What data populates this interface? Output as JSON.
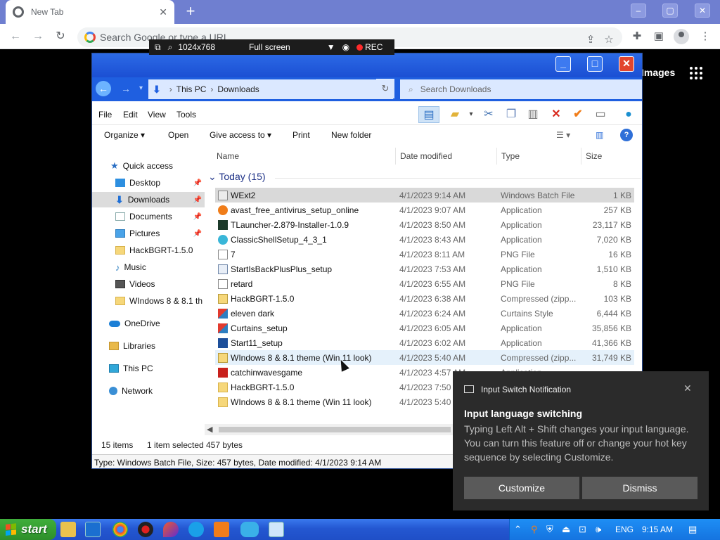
{
  "browser": {
    "tab_title": "New Tab",
    "omnibox_placeholder": "Search Google or type a URL"
  },
  "recorder": {
    "resolution": "1024x768",
    "mode": "Full screen",
    "rec_label": "REC"
  },
  "chrome_page": {
    "images_link": "Images"
  },
  "explorer": {
    "breadcrumb": [
      "This PC",
      "Downloads"
    ],
    "search_placeholder": "Search Downloads",
    "menu": [
      "File",
      "Edit",
      "View",
      "Tools"
    ],
    "commands": [
      "Organize",
      "Open",
      "Give access to",
      "Print",
      "New folder"
    ],
    "nav": [
      {
        "label": "Quick access",
        "icon": "star-icon",
        "pinned": false
      },
      {
        "label": "Desktop",
        "icon": "desktop-icon",
        "pinned": true
      },
      {
        "label": "Downloads",
        "icon": "download-icon",
        "pinned": true,
        "selected": true
      },
      {
        "label": "Documents",
        "icon": "document-icon",
        "pinned": true
      },
      {
        "label": "Pictures",
        "icon": "pictures-icon",
        "pinned": true
      },
      {
        "label": "HackBGRT-1.5.0",
        "icon": "folder-icon",
        "pinned": false
      },
      {
        "label": "Music",
        "icon": "music-icon",
        "pinned": false
      },
      {
        "label": "Videos",
        "icon": "videos-icon",
        "pinned": false
      },
      {
        "label": "WIndows 8 & 8.1 th",
        "icon": "folder-icon",
        "pinned": false
      },
      {
        "label": "OneDrive",
        "icon": "cloud-icon",
        "pinned": false
      },
      {
        "label": "Libraries",
        "icon": "libraries-icon",
        "pinned": false
      },
      {
        "label": "This PC",
        "icon": "computer-icon",
        "pinned": false
      },
      {
        "label": "Network",
        "icon": "network-icon",
        "pinned": false
      }
    ],
    "columns": [
      "Name",
      "Date modified",
      "Type",
      "Size"
    ],
    "group_label": "Today (15)",
    "files": [
      {
        "name": "WExt2",
        "date": "4/1/2023 9:14 AM",
        "type": "Windows Batch File",
        "size": "1 KB",
        "icon": "batch-file-icon"
      },
      {
        "name": "avast_free_antivirus_setup_online",
        "date": "4/1/2023 9:07 AM",
        "type": "Application",
        "size": "257 KB",
        "icon": "avast-icon"
      },
      {
        "name": "TLauncher-2.879-Installer-1.0.9",
        "date": "4/1/2023 8:50 AM",
        "type": "Application",
        "size": "23,117 KB",
        "icon": "tlauncher-icon"
      },
      {
        "name": "ClassicShellSetup_4_3_1",
        "date": "4/1/2023 8:43 AM",
        "type": "Application",
        "size": "7,020 KB",
        "icon": "shell-icon"
      },
      {
        "name": "7",
        "date": "4/1/2023 8:11 AM",
        "type": "PNG File",
        "size": "16 KB",
        "icon": "image-file-icon"
      },
      {
        "name": "StartIsBackPlusPlus_setup",
        "date": "4/1/2023 7:53 AM",
        "type": "Application",
        "size": "1,510 KB",
        "icon": "app-icon"
      },
      {
        "name": "retard",
        "date": "4/1/2023 6:55 AM",
        "type": "PNG File",
        "size": "8 KB",
        "icon": "image-file-icon"
      },
      {
        "name": "HackBGRT-1.5.0",
        "date": "4/1/2023 6:38 AM",
        "type": "Compressed (zipp...",
        "size": "103 KB",
        "icon": "zip-folder-icon"
      },
      {
        "name": "eleven dark",
        "date": "4/1/2023 6:24 AM",
        "type": "Curtains Style",
        "size": "6,444 KB",
        "icon": "curtains-icon"
      },
      {
        "name": "Curtains_setup",
        "date": "4/1/2023 6:05 AM",
        "type": "Application",
        "size": "35,856 KB",
        "icon": "curtains-setup-icon"
      },
      {
        "name": "Start11_setup",
        "date": "4/1/2023 6:02 AM",
        "type": "Application",
        "size": "41,366 KB",
        "icon": "start11-icon"
      },
      {
        "name": "WIndows 8 & 8.1 theme (Win 11 look)",
        "date": "4/1/2023 5:40 AM",
        "type": "Compressed (zipp...",
        "size": "31,749 KB",
        "icon": "zip-folder-icon"
      },
      {
        "name": "catchinwavesgame",
        "date": "4/1/2023 4:57 AM",
        "type": "Application",
        "size": "",
        "icon": "flash-icon"
      },
      {
        "name": "HackBGRT-1.5.0",
        "date": "4/1/2023 7:50 A",
        "type": "",
        "size": "",
        "icon": "folder-icon"
      },
      {
        "name": "WIndows 8 & 8.1 theme (Win 11 look)",
        "date": "4/1/2023 5:40 A",
        "type": "",
        "size": "",
        "icon": "folder-icon"
      }
    ],
    "status": {
      "count": "15 items",
      "selected": "1 item selected",
      "size": "457 bytes"
    },
    "details": "Type: Windows Batch File, Size: 457 bytes, Date modified: 4/1/2023 9:14 AM"
  },
  "toast": {
    "app": "Input Switch Notification",
    "title": "Input language switching",
    "body": "Typing Left Alt + Shift changes your input language. You can turn this feature off or change your hot key sequence by selecting Customize.",
    "btn_customize": "Customize",
    "btn_dismiss": "Dismiss"
  },
  "taskbar": {
    "start_label": "start",
    "language": "ENG",
    "clock": "9:15 AM"
  },
  "colors": {
    "chrome_tabbar": "#6f7fd0",
    "explorer_title": "#1f5fe0",
    "taskbar": "#2457d1",
    "start_button": "#3fae3b",
    "toast_bg": "#2b2b2b"
  }
}
